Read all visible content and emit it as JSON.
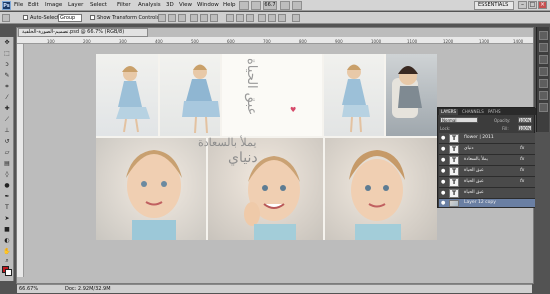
{
  "app": {
    "logo": "Ps",
    "menus": [
      "File",
      "Edit",
      "Image",
      "Layer",
      "Select",
      "Filter",
      "Analysis",
      "3D",
      "View",
      "Window",
      "Help"
    ],
    "zoom_btn": "66.7",
    "workspace": "ESSENTIALS",
    "window_controls": [
      "–",
      "□",
      "×"
    ]
  },
  "options": {
    "auto_select_label": "Auto-Select:",
    "auto_select_value": "Group",
    "transform_label": "Show Transform Controls"
  },
  "document": {
    "tab_title": "تصميم-الصورة-الخلفية.psd @ 66.7% (RGB/8)",
    "zoom": "66.67%",
    "doc_size": "Doc: 2.92M/32.9M",
    "ruler_ticks": [
      "100",
      "200",
      "300",
      "400",
      "500",
      "600",
      "700",
      "800",
      "900",
      "1000",
      "1100",
      "1200",
      "1300",
      "1400"
    ]
  },
  "canvas_text": {
    "heading_1": "عبق الحياة",
    "heading_2": "يملأ بالسعادة",
    "heading_3": "دنياي"
  },
  "layers_panel": {
    "tabs": [
      "LAYERS",
      "CHANNELS",
      "PATHS"
    ],
    "blend_mode": "Normal",
    "opacity_label": "Opacity:",
    "opacity_value": "100%",
    "lock_label": "Lock:",
    "fill_label": "Fill:",
    "fill_value": "100%",
    "layers": [
      {
        "name": "flower | 2011",
        "type": "T",
        "fx": "",
        "selected": false
      },
      {
        "name": "دنياي",
        "type": "T",
        "fx": "fx",
        "selected": false
      },
      {
        "name": "يملأ بالسعادة",
        "type": "T",
        "fx": "fx",
        "selected": false
      },
      {
        "name": "عبق الحياة",
        "type": "T",
        "fx": "fx",
        "selected": false
      },
      {
        "name": "عبق الحياة",
        "type": "T",
        "fx": "fx",
        "selected": false
      },
      {
        "name": "عبق الحياة",
        "type": "T",
        "fx": "",
        "selected": false
      },
      {
        "name": "Layer 12 copy",
        "type": "img",
        "fx": "",
        "selected": true
      }
    ]
  },
  "colors": {
    "foreground": "#c1181e",
    "background": "#ffffff",
    "accent": "#6a7fa3"
  }
}
